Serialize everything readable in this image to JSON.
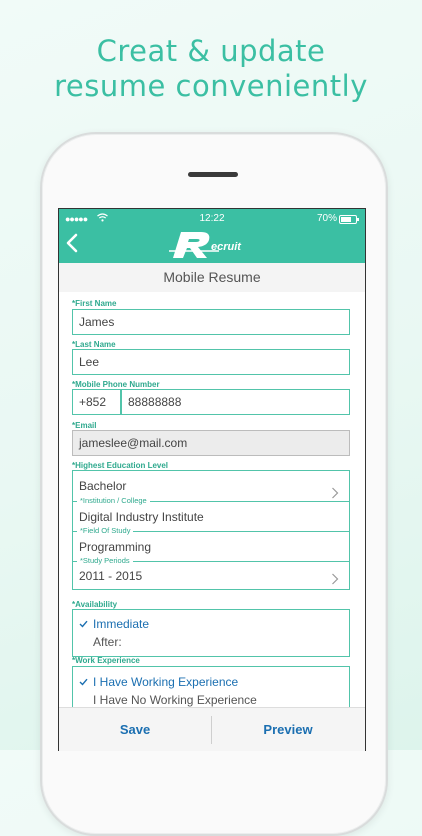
{
  "headline": {
    "line1": "Creat & update",
    "line2": "resume conveniently"
  },
  "status_bar": {
    "signal": "●●●●●",
    "time": "12:22",
    "battery": "70%"
  },
  "header": {
    "logo_text": "Recruit",
    "page_title": "Mobile Resume"
  },
  "form": {
    "first_name": {
      "label": "*First Name",
      "value": "James"
    },
    "last_name": {
      "label": "*Last Name",
      "value": "Lee"
    },
    "mobile": {
      "label": "*Mobile Phone Number",
      "code": "+852",
      "number": "88888888"
    },
    "email": {
      "label": "*Email",
      "value": "jameslee@mail.com"
    },
    "education": {
      "label": "*Highest Education Level",
      "level": "Bachelor",
      "institution_label": "*Institution / College",
      "institution": "Digital Industry Institute",
      "field_label": "*Field Of Study",
      "field": "Programming",
      "period_label": "*Study Periods",
      "period": "2011 - 2015"
    },
    "availability": {
      "label": "*Availability",
      "selected": "Immediate",
      "after": "After:"
    },
    "work_experience": {
      "label": "*Work Experience",
      "option_yes": "I Have Working Experience",
      "option_no": "I Have No Working Experience"
    }
  },
  "actions": {
    "save": "Save",
    "preview": "Preview"
  },
  "colors": {
    "accent": "#3bbfa3",
    "link": "#1b6fb1"
  }
}
